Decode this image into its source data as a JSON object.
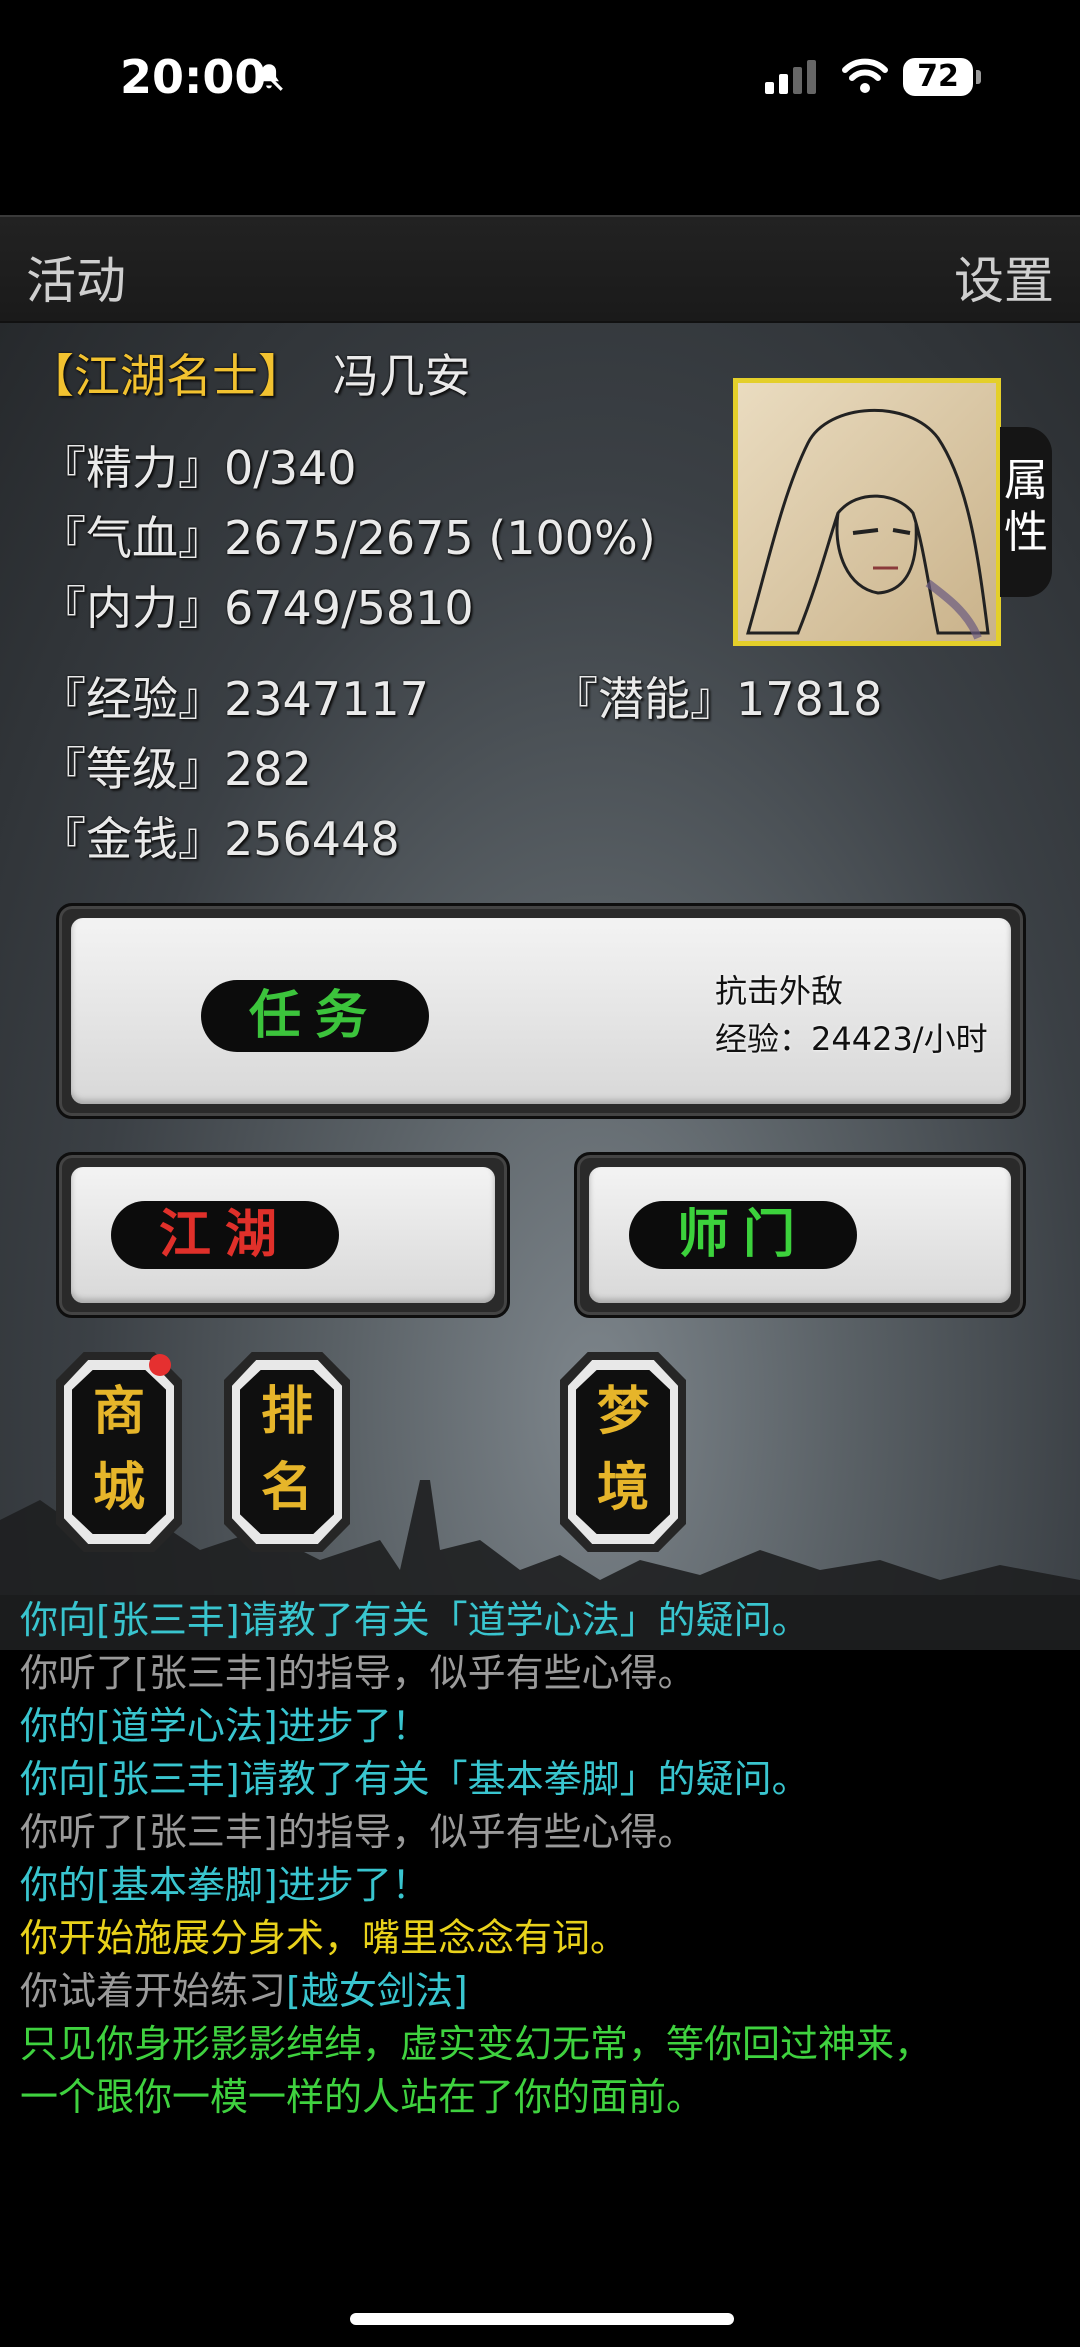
{
  "status_bar": {
    "time": "20:00",
    "battery": "72"
  },
  "topbar": {
    "left": "活动",
    "right": "设置"
  },
  "profile": {
    "title": "【江湖名士】",
    "name": "冯几安",
    "attr_tab": "属性",
    "stats": {
      "jingli": "『精力』0/340",
      "qixue": "『气血』2675/2675 (100%)",
      "neili": "『内力』6749/5810",
      "jingyan": "『经验』2347117",
      "qianneng": "『潜能』17818",
      "dengji": "『等级』282",
      "jinqian": "『金钱』256448"
    }
  },
  "task": {
    "label": "任务",
    "desc_line1": "抗击外敌",
    "desc_line2": "经验：24423/小时"
  },
  "buttons": {
    "jianghu": "江湖",
    "shimen": "师门"
  },
  "small_buttons": [
    {
      "label_top": "商",
      "label_bottom": "城"
    },
    {
      "label_top": "排",
      "label_bottom": "名"
    },
    {
      "label_top": "梦",
      "label_bottom": "境"
    }
  ],
  "log": [
    "你向[张三丰]请教了有关「道学心法」的疑问。",
    "你听了[张三丰]的指导，似乎有些心得。",
    "你的[道学心法]进步了！",
    "你向[张三丰]请教了有关「基本拳脚」的疑问。",
    "你听了[张三丰]的指导，似乎有些心得。",
    "你的[基本拳脚]进步了！",
    "你开始施展分身术，嘴里念念有词。",
    "你试着开始练习",
    "[越女剑法]",
    "只见你身形影影绰绰，虚实变幻无常，等你回过神来，",
    "一个跟你一模一样的人站在了你的面前。"
  ],
  "colors": {
    "cyan": "#39c5cf",
    "gray": "#9a9a9a",
    "yellow": "#e9d21b",
    "green": "#3fd23f",
    "task_green": "#3cc43c",
    "jianghu_red": "#e0302a",
    "shimen_green": "#3cd23c",
    "gold": "#e6b52a"
  }
}
